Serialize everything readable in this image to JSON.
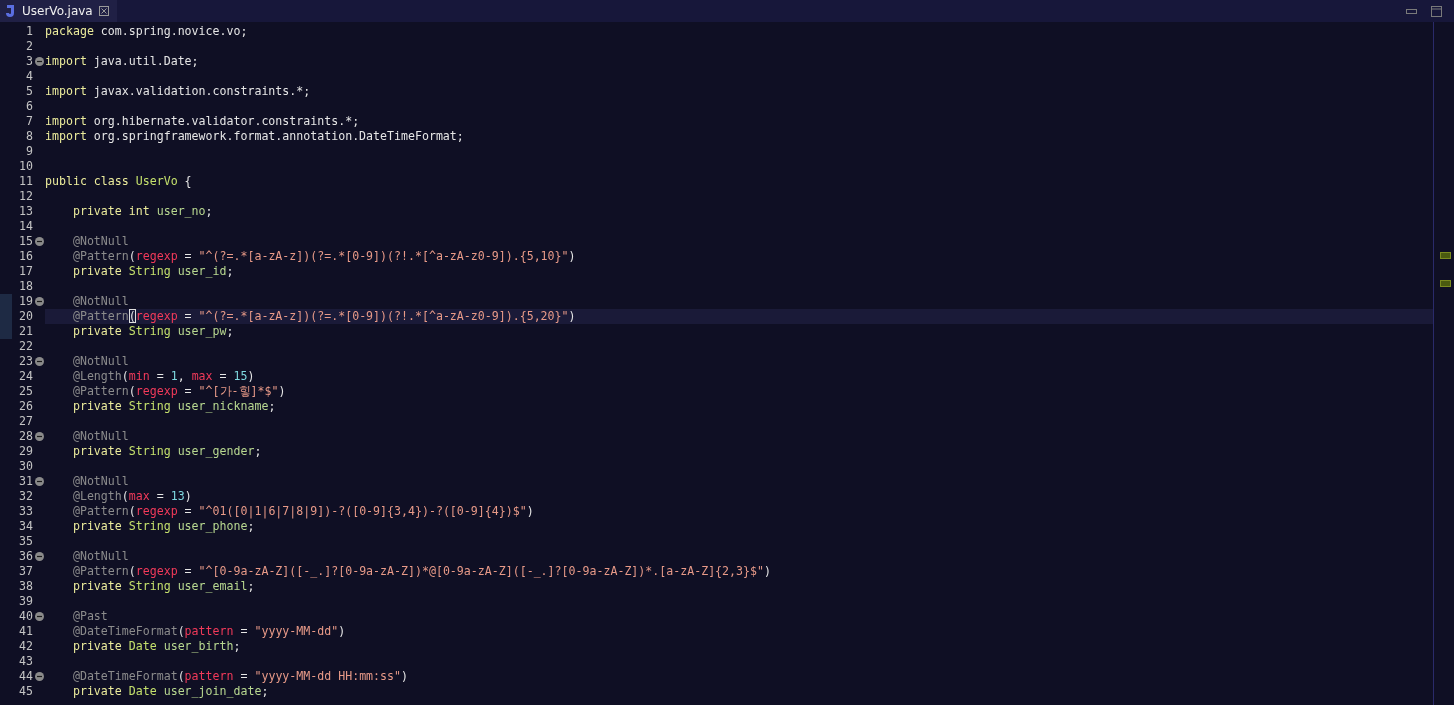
{
  "tab": {
    "label": "UserVo.java",
    "selected": true
  },
  "lines": [
    {
      "n": "1",
      "tokens": [
        {
          "kind": "kw",
          "t": "package"
        },
        {
          "kind": "plain",
          "t": " com.spring.novice.vo;"
        }
      ]
    },
    {
      "n": "2"
    },
    {
      "n": "3",
      "fold": true,
      "tokens": [
        {
          "kind": "kw",
          "t": "import"
        },
        {
          "kind": "plain",
          "t": " java.util.Date;"
        }
      ]
    },
    {
      "n": "4"
    },
    {
      "n": "5",
      "tokens": [
        {
          "kind": "kw",
          "t": "import"
        },
        {
          "kind": "plain",
          "t": " javax.validation.constraints.*;"
        }
      ]
    },
    {
      "n": "6"
    },
    {
      "n": "7",
      "tokens": [
        {
          "kind": "kw",
          "t": "import"
        },
        {
          "kind": "plain",
          "t": " org.hibernate.validator.constraints.*;"
        }
      ]
    },
    {
      "n": "8",
      "tokens": [
        {
          "kind": "kw",
          "t": "import"
        },
        {
          "kind": "plain",
          "t": " org.springframework.format.annotation.DateTimeFormat;"
        }
      ]
    },
    {
      "n": "9"
    },
    {
      "n": "10"
    },
    {
      "n": "11",
      "tokens": [
        {
          "kind": "kw",
          "t": "public class "
        },
        {
          "kind": "type",
          "t": "UserVo"
        },
        {
          "kind": "plain",
          "t": " {"
        }
      ]
    },
    {
      "n": "12"
    },
    {
      "n": "13",
      "tokens": [
        {
          "kind": "kw",
          "t": "    private int "
        },
        {
          "kind": "field",
          "t": "user_no"
        },
        {
          "kind": "plain",
          "t": ";"
        }
      ]
    },
    {
      "n": "14"
    },
    {
      "n": "15",
      "fold": true,
      "tokens": [
        {
          "kind": "ann",
          "t": "    @NotNull"
        }
      ]
    },
    {
      "n": "16",
      "tokens": [
        {
          "kind": "ann",
          "t": "    @Pattern"
        },
        {
          "kind": "plain",
          "t": "("
        },
        {
          "kind": "attr",
          "t": "regexp"
        },
        {
          "kind": "plain",
          "t": " = "
        },
        {
          "kind": "str",
          "t": "\"^(?=.*[a-zA-z])(?=.*[0-9])(?!.*[^a-zA-z0-9]).{5,10}\""
        },
        {
          "kind": "plain",
          "t": ")"
        }
      ]
    },
    {
      "n": "17",
      "tokens": [
        {
          "kind": "kw",
          "t": "    private "
        },
        {
          "kind": "type",
          "t": "String"
        },
        {
          "kind": "field",
          "t": " user_id"
        },
        {
          "kind": "plain",
          "t": ";"
        }
      ]
    },
    {
      "n": "18"
    },
    {
      "n": "19",
      "fold": true,
      "changed": true,
      "tokens": [
        {
          "kind": "ann",
          "t": "    @NotNull"
        }
      ]
    },
    {
      "n": "20",
      "current": true,
      "changed": true,
      "tokens": [
        {
          "kind": "ann",
          "t": "    @Pattern"
        },
        {
          "kind": "match",
          "t": "("
        },
        {
          "kind": "attr",
          "t": "regexp"
        },
        {
          "kind": "plain",
          "t": " = "
        },
        {
          "kind": "str",
          "t": "\"^(?=.*[a-zA-z])(?=.*[0-9])(?!.*[^a-zA-z0-9]).{5,20}\""
        },
        {
          "kind": "plain",
          "t": ")"
        }
      ]
    },
    {
      "n": "21",
      "changed": true,
      "tokens": [
        {
          "kind": "kw",
          "t": "    private "
        },
        {
          "kind": "type",
          "t": "String"
        },
        {
          "kind": "field",
          "t": " user_pw"
        },
        {
          "kind": "plain",
          "t": ";"
        }
      ]
    },
    {
      "n": "22"
    },
    {
      "n": "23",
      "fold": true,
      "tokens": [
        {
          "kind": "ann",
          "t": "    @NotNull"
        }
      ]
    },
    {
      "n": "24",
      "tokens": [
        {
          "kind": "ann",
          "t": "    @Length"
        },
        {
          "kind": "plain",
          "t": "("
        },
        {
          "kind": "attr",
          "t": "min"
        },
        {
          "kind": "plain",
          "t": " = "
        },
        {
          "kind": "num",
          "t": "1"
        },
        {
          "kind": "plain",
          "t": ", "
        },
        {
          "kind": "attr",
          "t": "max"
        },
        {
          "kind": "plain",
          "t": " = "
        },
        {
          "kind": "num",
          "t": "15"
        },
        {
          "kind": "plain",
          "t": ")"
        }
      ]
    },
    {
      "n": "25",
      "tokens": [
        {
          "kind": "ann",
          "t": "    @Pattern"
        },
        {
          "kind": "plain",
          "t": "("
        },
        {
          "kind": "attr",
          "t": "regexp"
        },
        {
          "kind": "plain",
          "t": " = "
        },
        {
          "kind": "str",
          "t": "\"^[가-힣]*$\""
        },
        {
          "kind": "plain",
          "t": ")"
        }
      ]
    },
    {
      "n": "26",
      "tokens": [
        {
          "kind": "kw",
          "t": "    private "
        },
        {
          "kind": "type",
          "t": "String"
        },
        {
          "kind": "field",
          "t": " user_nickname"
        },
        {
          "kind": "plain",
          "t": ";"
        }
      ]
    },
    {
      "n": "27"
    },
    {
      "n": "28",
      "fold": true,
      "tokens": [
        {
          "kind": "ann",
          "t": "    @NotNull"
        }
      ]
    },
    {
      "n": "29",
      "tokens": [
        {
          "kind": "kw",
          "t": "    private "
        },
        {
          "kind": "type",
          "t": "String"
        },
        {
          "kind": "field",
          "t": " user_gender"
        },
        {
          "kind": "plain",
          "t": ";"
        }
      ]
    },
    {
      "n": "30"
    },
    {
      "n": "31",
      "fold": true,
      "tokens": [
        {
          "kind": "ann",
          "t": "    @NotNull"
        }
      ]
    },
    {
      "n": "32",
      "tokens": [
        {
          "kind": "ann",
          "t": "    @Length"
        },
        {
          "kind": "plain",
          "t": "("
        },
        {
          "kind": "attr",
          "t": "max"
        },
        {
          "kind": "plain",
          "t": " = "
        },
        {
          "kind": "num",
          "t": "13"
        },
        {
          "kind": "plain",
          "t": ")"
        }
      ]
    },
    {
      "n": "33",
      "tokens": [
        {
          "kind": "ann",
          "t": "    @Pattern"
        },
        {
          "kind": "plain",
          "t": "("
        },
        {
          "kind": "attr",
          "t": "regexp"
        },
        {
          "kind": "plain",
          "t": " = "
        },
        {
          "kind": "str",
          "t": "\"^01([0|1|6|7|8|9])-?([0-9]{3,4})-?([0-9]{4})$\""
        },
        {
          "kind": "plain",
          "t": ")"
        }
      ]
    },
    {
      "n": "34",
      "tokens": [
        {
          "kind": "kw",
          "t": "    private "
        },
        {
          "kind": "type",
          "t": "String"
        },
        {
          "kind": "field",
          "t": " user_phone"
        },
        {
          "kind": "plain",
          "t": ";"
        }
      ]
    },
    {
      "n": "35"
    },
    {
      "n": "36",
      "fold": true,
      "tokens": [
        {
          "kind": "ann",
          "t": "    @NotNull"
        }
      ]
    },
    {
      "n": "37",
      "tokens": [
        {
          "kind": "ann",
          "t": "    @Pattern"
        },
        {
          "kind": "plain",
          "t": "("
        },
        {
          "kind": "attr",
          "t": "regexp"
        },
        {
          "kind": "plain",
          "t": " = "
        },
        {
          "kind": "str",
          "t": "\"^[0-9a-zA-Z]([-_.]?[0-9a-zA-Z])*@[0-9a-zA-Z]([-_.]?[0-9a-zA-Z])*.[a-zA-Z]{2,3}$\""
        },
        {
          "kind": "plain",
          "t": ")"
        }
      ]
    },
    {
      "n": "38",
      "tokens": [
        {
          "kind": "kw",
          "t": "    private "
        },
        {
          "kind": "type",
          "t": "String"
        },
        {
          "kind": "field",
          "t": " user_email"
        },
        {
          "kind": "plain",
          "t": ";"
        }
      ]
    },
    {
      "n": "39"
    },
    {
      "n": "40",
      "fold": true,
      "tokens": [
        {
          "kind": "ann",
          "t": "    @Past"
        }
      ]
    },
    {
      "n": "41",
      "tokens": [
        {
          "kind": "ann",
          "t": "    @DateTimeFormat"
        },
        {
          "kind": "plain",
          "t": "("
        },
        {
          "kind": "attr",
          "t": "pattern"
        },
        {
          "kind": "plain",
          "t": " = "
        },
        {
          "kind": "str",
          "t": "\"yyyy-MM-dd\""
        },
        {
          "kind": "plain",
          "t": ")"
        }
      ]
    },
    {
      "n": "42",
      "tokens": [
        {
          "kind": "kw",
          "t": "    private "
        },
        {
          "kind": "type",
          "t": "Date"
        },
        {
          "kind": "field",
          "t": " user_birth"
        },
        {
          "kind": "plain",
          "t": ";"
        }
      ]
    },
    {
      "n": "43"
    },
    {
      "n": "44",
      "fold": true,
      "tokens": [
        {
          "kind": "ann",
          "t": "    @DateTimeFormat"
        },
        {
          "kind": "plain",
          "t": "("
        },
        {
          "kind": "attr",
          "t": "pattern"
        },
        {
          "kind": "plain",
          "t": " = "
        },
        {
          "kind": "str",
          "t": "\"yyyy-MM-dd HH:mm:ss\""
        },
        {
          "kind": "plain",
          "t": ")"
        }
      ]
    },
    {
      "n": "45",
      "tokens": [
        {
          "kind": "kw",
          "t": "    private "
        },
        {
          "kind": "type",
          "t": "Date"
        },
        {
          "kind": "field",
          "t": " user_join_date"
        },
        {
          "kind": "plain",
          "t": ";"
        }
      ]
    }
  ]
}
